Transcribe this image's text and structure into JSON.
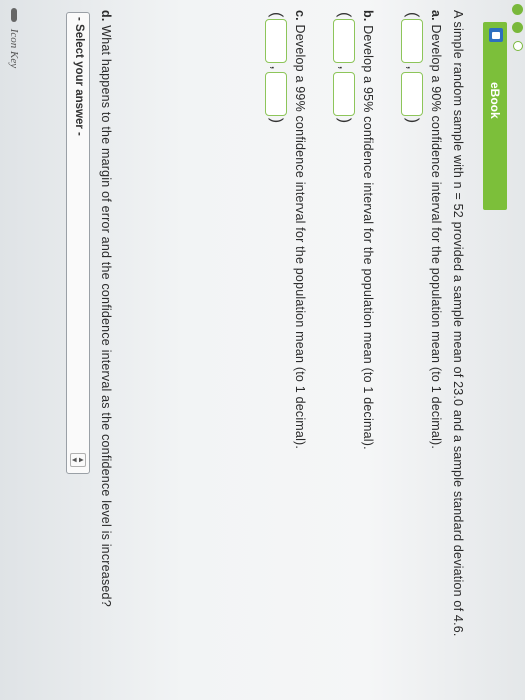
{
  "ebook": {
    "label": "eBook",
    "icon": "ebook-icon"
  },
  "question": {
    "intro": "A simple random sample with n = 52 provided a sample mean of 23.0 and a sample standard deviation of 4.6.",
    "part_a": {
      "letter": "a.",
      "text": "Develop a 90% confidence interval for the population mean (to 1 decimal)."
    },
    "part_b": {
      "letter": "b.",
      "text": "Develop a 95% confidence interval for the population mean (to 1 decimal)."
    },
    "part_c": {
      "letter": "c.",
      "text": "Develop a 99% confidence interval for the population mean (to 1 decimal)."
    },
    "part_d": {
      "letter": "d.",
      "text": "What happens to the margin of error and the confidence interval as the confidence level is increased?"
    }
  },
  "interval": {
    "open": "(",
    "sep": ",",
    "close": ")"
  },
  "select": {
    "value": "- Select your answer -",
    "arrows_up": "▲",
    "arrows_down": "▼"
  },
  "icon_key": {
    "label": "Icon Key",
    "icon": "key-icon"
  },
  "colors": {
    "accent": "#7cbf3a",
    "field_border": "#8dc55a",
    "ebook_icon": "#2d6fbf"
  }
}
